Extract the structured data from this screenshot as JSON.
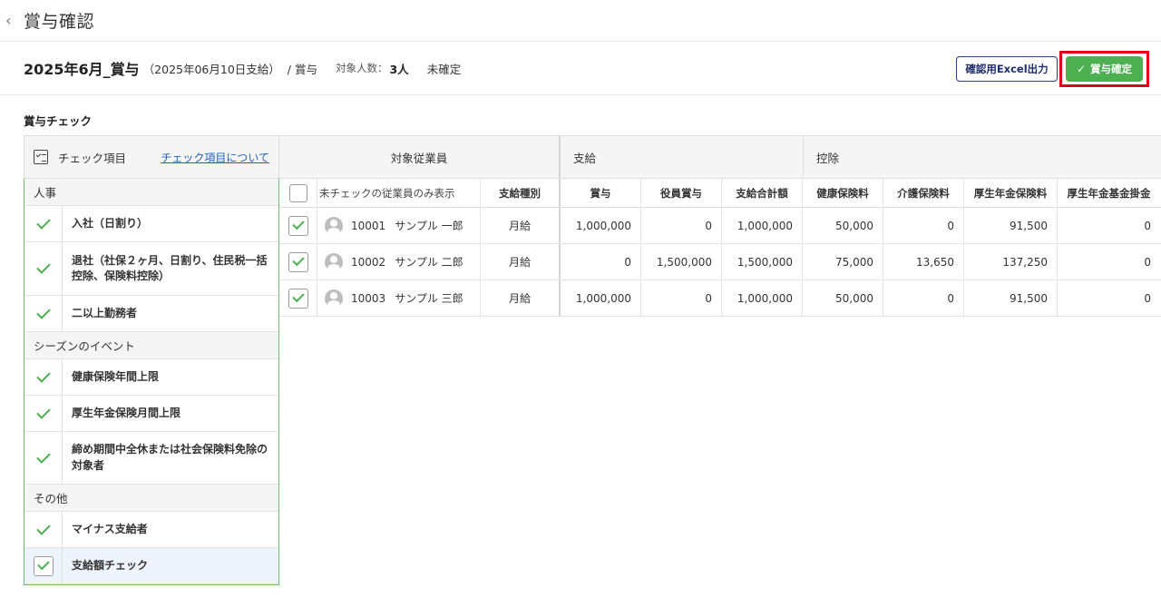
{
  "header": {
    "back_icon": "chevron-left-icon",
    "title": "賞与確認"
  },
  "info": {
    "bonus_name": "2025年6月_賞与",
    "pay_date": "（2025年06月10日支給）",
    "type": "/ 賞与",
    "count_label": "対象人数：",
    "count_value": "3人",
    "status": "未確定",
    "excel_button": "確認用Excel出力",
    "confirm_button": "賞与確定"
  },
  "section_title": "賞与チェック",
  "check_panel": {
    "header_label": "チェック項目",
    "header_link": "チェック項目について",
    "categories": [
      {
        "name": "人事",
        "items": [
          {
            "label": "入社（日割り）"
          },
          {
            "label": "退社（社保２ヶ月、日割り、住民税一括控除、保険料控除）"
          },
          {
            "label": "二以上勤務者"
          }
        ]
      },
      {
        "name": "シーズンのイベント",
        "items": [
          {
            "label": "健康保険年間上限"
          },
          {
            "label": "厚生年金保険月間上限"
          },
          {
            "label": "締め期間中全休または社会保険料免除の対象者"
          }
        ]
      },
      {
        "name": "その他",
        "items": [
          {
            "label": "マイナス支給者"
          },
          {
            "label": "支給額チェック"
          }
        ]
      }
    ]
  },
  "table": {
    "groups": {
      "employee": "対象従業員",
      "payment": "支給",
      "deduction": "控除"
    },
    "headers": {
      "filter_label": "未チェックの従業員のみ表示",
      "kind": "支給種別",
      "bonus": "賞与",
      "officer_bonus": "役員賞与",
      "pay_total": "支給合計額",
      "health": "健康保険料",
      "care": "介護保険料",
      "pension": "厚生年金保険料",
      "pension_fund": "厚生年金基金掛金"
    },
    "rows": [
      {
        "code": "10001",
        "name": "サンプル 一郎",
        "kind": "月給",
        "bonus": "1,000,000",
        "officer_bonus": "0",
        "pay_total": "1,000,000",
        "health": "50,000",
        "care": "0",
        "pension": "91,500",
        "pension_fund": "0"
      },
      {
        "code": "10002",
        "name": "サンプル 二郎",
        "kind": "月給",
        "bonus": "0",
        "officer_bonus": "1,500,000",
        "pay_total": "1,500,000",
        "health": "75,000",
        "care": "13,650",
        "pension": "137,250",
        "pension_fund": "0"
      },
      {
        "code": "10003",
        "name": "サンプル 三郎",
        "kind": "月給",
        "bonus": "1,000,000",
        "officer_bonus": "0",
        "pay_total": "1,000,000",
        "health": "50,000",
        "care": "0",
        "pension": "91,500",
        "pension_fund": "0"
      }
    ]
  },
  "colors": {
    "accent_green": "#4caf50",
    "highlight_red": "#e0001a",
    "link_blue": "#1a62c4",
    "excel_navy": "#2a3f86"
  }
}
